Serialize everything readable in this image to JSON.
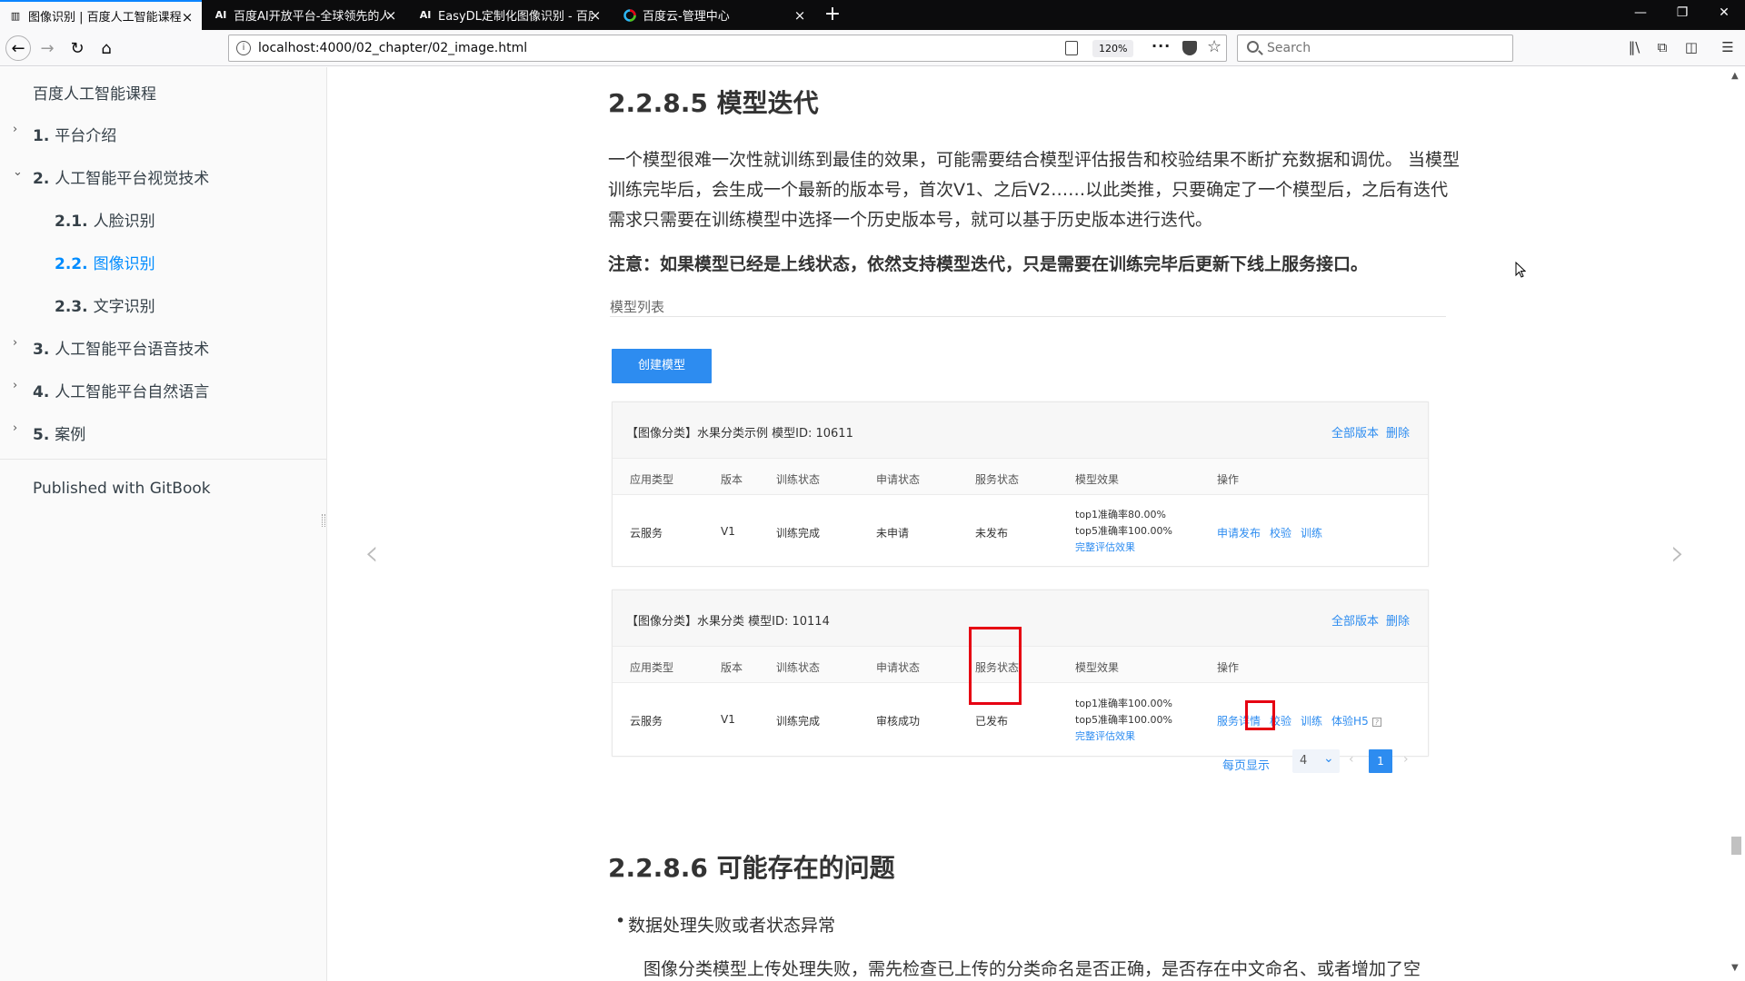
{
  "browser": {
    "tabs": [
      {
        "icon": "book-icon",
        "title": "图像识别 | 百度人工智能课程",
        "active": true
      },
      {
        "icon": "ai-icon",
        "title": "百度AI开放平台-全球领先的人",
        "active": false
      },
      {
        "icon": "ai-icon",
        "title": "EasyDL定制化图像识别 - 百度",
        "active": false
      },
      {
        "icon": "baidu-cloud-icon",
        "title": "百度云-管理中心",
        "active": false
      }
    ],
    "url": "localhost:4000/02_chapter/02_image.html",
    "zoom": "120%",
    "search_placeholder": "Search"
  },
  "sidebar": {
    "title": "百度人工智能课程",
    "items": [
      {
        "num": "1.",
        "label": "平台介绍",
        "level": 1,
        "chevron": "›"
      },
      {
        "num": "2.",
        "label": "人工智能平台视觉技术",
        "level": 1,
        "chevron": "⌄"
      },
      {
        "num": "2.1.",
        "label": "人脸识别",
        "level": 2
      },
      {
        "num": "2.2.",
        "label": "图像识别",
        "level": 2,
        "active": true
      },
      {
        "num": "2.3.",
        "label": "文字识别",
        "level": 2
      },
      {
        "num": "3.",
        "label": "人工智能平台语音技术",
        "level": 1,
        "chevron": "›"
      },
      {
        "num": "4.",
        "label": "人工智能平台自然语言",
        "level": 1,
        "chevron": "›"
      },
      {
        "num": "5.",
        "label": "案例",
        "level": 1,
        "chevron": "›"
      }
    ],
    "published": "Published with GitBook"
  },
  "content": {
    "heading_1": "2.2.8.5 模型迭代",
    "paragraph_1": "一个模型很难一次性就训练到最佳的效果，可能需要结合模型评估报告和校验结果不断扩充数据和调优。 当模型训练完毕后，会生成一个最新的版本号，首次V1、之后V2……以此类推，只要确定了一个模型后，之后有迭代需求只需要在训练模型中选择一个历史版本号，就可以基于历史版本进行迭代。",
    "note": "注意：如果模型已经是上线状态，依然支持模型迭代，只是需要在训练完毕后更新下线上服务接口。",
    "screenshot": {
      "section_title": "模型列表",
      "create_button": "创建模型",
      "columns": [
        "应用类型",
        "版本",
        "训练状态",
        "申请状态",
        "服务状态",
        "模型效果",
        "操作"
      ],
      "models": [
        {
          "name": "【图像分类】水果分类示例 模型ID:  10611",
          "links": [
            "全部版本",
            "删除"
          ],
          "row": {
            "app_type": "云服务",
            "version": "V1",
            "train_status": "训练完成",
            "apply_status": "未申请",
            "service_status": "未发布"
          },
          "metrics": [
            "top1准确率80.00%",
            "top5准确率100.00%",
            "完整评估效果"
          ],
          "ops": [
            "申请发布",
            "校验",
            "训练"
          ]
        },
        {
          "name": "【图像分类】水果分类 模型ID:  10114",
          "links": [
            "全部版本",
            "删除"
          ],
          "row": {
            "app_type": "云服务",
            "version": "V1",
            "train_status": "训练完成",
            "apply_status": "审核成功",
            "service_status": "已发布"
          },
          "metrics": [
            "top1准确率100.00%",
            "top5准确率100.00%",
            "完整评估效果"
          ],
          "ops": [
            "服务详情",
            "校验",
            "训练",
            "体验H5"
          ],
          "help": "?"
        }
      ],
      "pagination": {
        "per_page_label": "每页显示",
        "per_page_value": "4",
        "current_page": "1"
      }
    },
    "heading_2": "2.2.8.6 可能存在的问题",
    "bullet_1": "数据处理失败或者状态异常",
    "paragraph_2": "图像分类模型上传处理失败，需先检查已上传的分类命名是否正确，是否存在中文命名、或者增加了空"
  },
  "colors": {
    "accent": "#2d8cf0",
    "sidebar_active": "#008cff",
    "highlight_box": "#e60012",
    "tab_bar": "#0c0c0d"
  }
}
